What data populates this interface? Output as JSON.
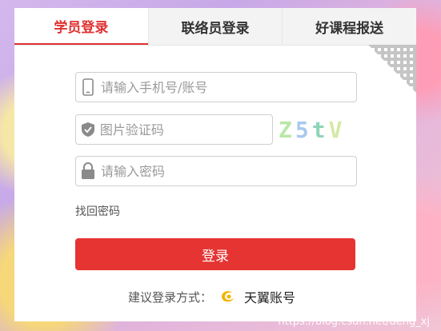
{
  "tabs": [
    {
      "label": "学员登录",
      "active": true
    },
    {
      "label": "联络员登录",
      "active": false
    },
    {
      "label": "好课程报送",
      "active": false
    }
  ],
  "form": {
    "phone_placeholder": "请输入手机号/账号",
    "captcha_placeholder": "图片验证码",
    "captcha_chars": [
      "Z",
      "5",
      "t",
      "V"
    ],
    "password_placeholder": "请输入密码",
    "forgot_label": "找回密码",
    "login_label": "登录"
  },
  "suggest": {
    "prefix": "建议登录方式：",
    "provider": "天翼账号",
    "provider_icon": "tianyi-logo-icon"
  },
  "watermark": "https://blog.csdn.net/deng_xj",
  "colors": {
    "accent": "#e53432",
    "tab_active": "#e03030"
  }
}
